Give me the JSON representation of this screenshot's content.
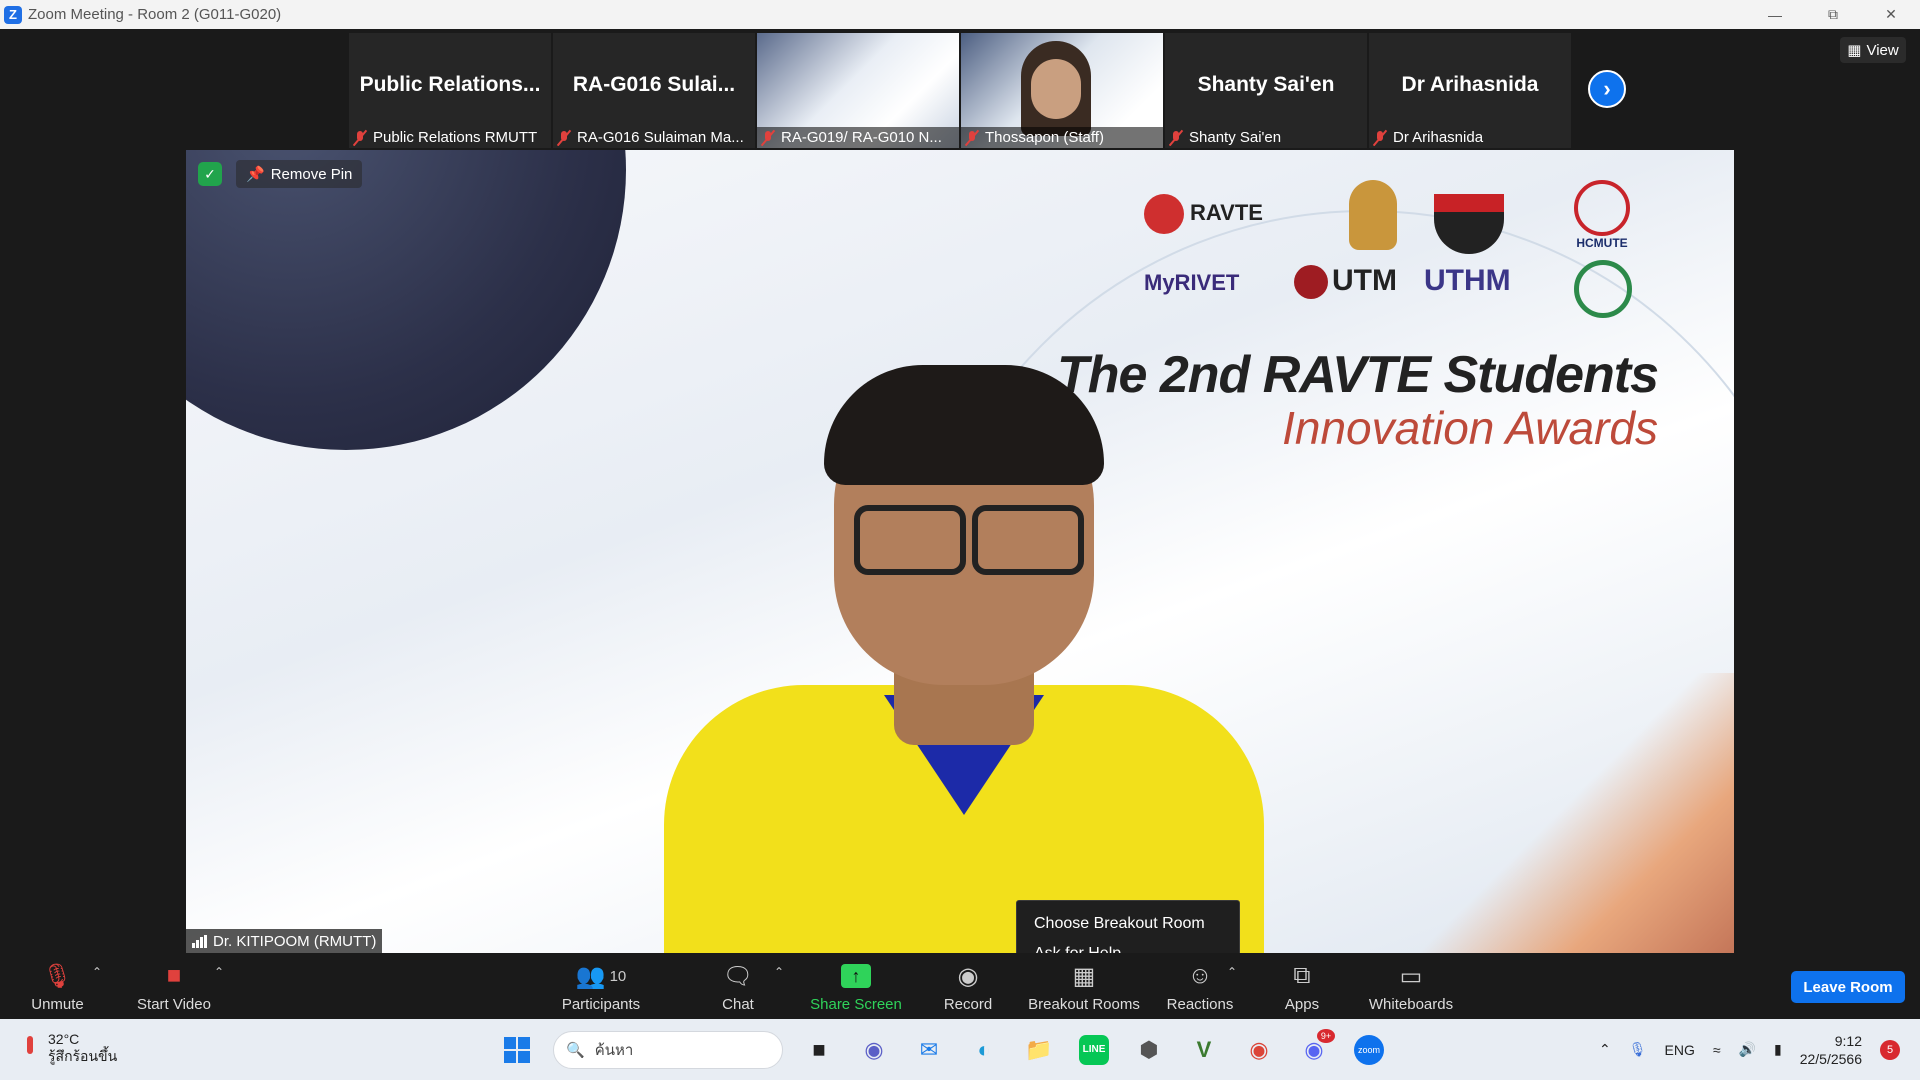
{
  "window": {
    "title": "Zoom Meeting - Room 2 (G011-G020)",
    "logo_letter": "Z"
  },
  "view_button": {
    "label": "View"
  },
  "participants_strip": [
    {
      "big_name": "Public  Relations...",
      "label": "Public Relations RMUTT",
      "has_video": false
    },
    {
      "big_name": "RA-G016  Sulai...",
      "label": "RA-G016 Sulaiman Ma...",
      "has_video": false
    },
    {
      "big_name": "",
      "label": "RA-G019/ RA-G010 N...",
      "has_video": true
    },
    {
      "big_name": "",
      "label": "Thossapon (Staff)",
      "has_video": true
    },
    {
      "big_name": "Shanty Sai'en",
      "label": "Shanty Sai'en",
      "has_video": false
    },
    {
      "big_name": "Dr Arihasnida",
      "label": "Dr Arihasnida",
      "has_video": false
    }
  ],
  "main_video": {
    "remove_pin_label": "Remove Pin",
    "speaker_name": "Dr. KITIPOOM (RMUTT)",
    "logos": [
      "RAVTE",
      "MyRIVET",
      "UTM",
      "UTHM",
      "HCMUTE"
    ],
    "award_line1": "The 2nd RAVTE Students",
    "award_line2": "Innovation Awards"
  },
  "context_menu": {
    "items": [
      "Choose Breakout Room",
      "Ask for Help"
    ]
  },
  "toolbar": {
    "unmute": "Unmute",
    "start_video": "Start Video",
    "participants": "Participants",
    "participants_count": "10",
    "chat": "Chat",
    "share_screen": "Share Screen",
    "record": "Record",
    "breakout_rooms": "Breakout Rooms",
    "reactions": "Reactions",
    "apps": "Apps",
    "whiteboards": "Whiteboards",
    "leave_room": "Leave Room"
  },
  "taskbar": {
    "weather_temp": "32°C",
    "weather_text": "รู้สึกร้อนขึ้น",
    "search_placeholder": "ค้นหา",
    "language": "ENG",
    "time": "9:12",
    "date": "22/5/2566",
    "notification_count": "5",
    "discord_badge": "9+"
  },
  "colors": {
    "accent": "#0e72ed",
    "share_green": "#2fd35a",
    "muted_red": "#e0413d"
  }
}
